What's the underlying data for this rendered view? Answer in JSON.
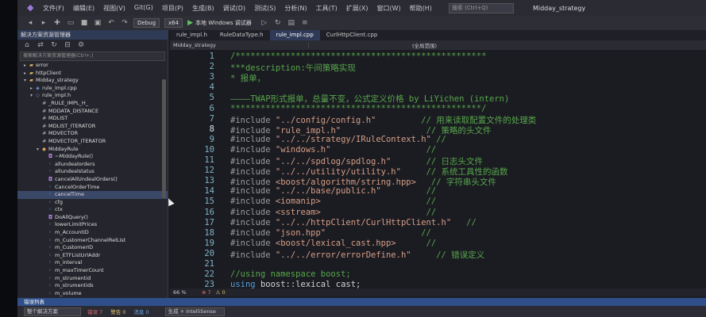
{
  "menubar": {
    "items": [
      "文件(F)",
      "编辑(E)",
      "视图(V)",
      "Git(G)",
      "项目(P)",
      "生成(B)",
      "调试(D)",
      "测试(S)",
      "分析(N)",
      "工具(T)",
      "扩展(X)",
      "窗口(W)",
      "帮助(H)"
    ],
    "search_placeholder": "搜索 (Ctrl+Q)",
    "app_title": "Midday_strategy"
  },
  "toolbar": {
    "config": "Debug",
    "platform": "x64",
    "run_label": "本地 Windows 调试器"
  },
  "solution_explorer": {
    "title": "解决方案资源管理器",
    "search_placeholder": "搜索解决方案资源管理器(Ctrl+;)",
    "items": [
      {
        "label": "error",
        "indent": 1,
        "arrow": "▸",
        "icon": "folder"
      },
      {
        "label": "httpClient",
        "indent": 1,
        "arrow": "▸",
        "icon": "folder"
      },
      {
        "label": "Midday_strategy",
        "indent": 1,
        "arrow": "▾",
        "icon": "folder"
      },
      {
        "label": "rule_impl.cpp",
        "indent": 2,
        "arrow": "▸",
        "icon": "cpp"
      },
      {
        "label": "rule_impl.h",
        "indent": 2,
        "arrow": "▾",
        "icon": "h"
      },
      {
        "label": "_RULE_IMPL_H_",
        "indent": 3,
        "arrow": "",
        "icon": "macro"
      },
      {
        "label": "MDDATA_DISTANCE",
        "indent": 3,
        "arrow": "",
        "icon": "macro"
      },
      {
        "label": "MDLIST",
        "indent": 3,
        "arrow": "",
        "icon": "macro"
      },
      {
        "label": "MDLIST_ITERATOR",
        "indent": 3,
        "arrow": "",
        "icon": "macro"
      },
      {
        "label": "MDVECTOR",
        "indent": 3,
        "arrow": "",
        "icon": "macro"
      },
      {
        "label": "MDVECTOR_ITERATOR",
        "indent": 3,
        "arrow": "",
        "icon": "macro"
      },
      {
        "label": "MiddayRule",
        "indent": 3,
        "arrow": "▾",
        "icon": "class"
      },
      {
        "label": "~MiddayRule()",
        "indent": 4,
        "arrow": "",
        "icon": "method"
      },
      {
        "label": "allundealorders",
        "indent": 4,
        "arrow": "",
        "icon": "field"
      },
      {
        "label": "allundealstatus",
        "indent": 4,
        "arrow": "",
        "icon": "field"
      },
      {
        "label": "cancelAllUndealOrders()",
        "indent": 4,
        "arrow": "",
        "icon": "method"
      },
      {
        "label": "CancelOrderTime",
        "indent": 4,
        "arrow": "",
        "icon": "field"
      },
      {
        "label": "cancelTime",
        "indent": 4,
        "arrow": "",
        "icon": "field",
        "selected": true
      },
      {
        "label": "cfg",
        "indent": 4,
        "arrow": "",
        "icon": "field"
      },
      {
        "label": "ctx",
        "indent": 4,
        "arrow": "",
        "icon": "field"
      },
      {
        "label": "DoAllQuery()",
        "indent": 4,
        "arrow": "",
        "icon": "method"
      },
      {
        "label": "lowerLimitPrices",
        "indent": 4,
        "arrow": "",
        "icon": "field"
      },
      {
        "label": "m_AccountID",
        "indent": 4,
        "arrow": "",
        "icon": "field"
      },
      {
        "label": "m_CustomerChannelRelList",
        "indent": 4,
        "arrow": "",
        "icon": "field"
      },
      {
        "label": "m_CustomerID",
        "indent": 4,
        "arrow": "",
        "icon": "field"
      },
      {
        "label": "m_ETFListUrlAddr",
        "indent": 4,
        "arrow": "",
        "icon": "field"
      },
      {
        "label": "m_interval",
        "indent": 4,
        "arrow": "",
        "icon": "field"
      },
      {
        "label": "m_maxTimerCount",
        "indent": 4,
        "arrow": "",
        "icon": "field"
      },
      {
        "label": "m_strumentid",
        "indent": 4,
        "arrow": "",
        "icon": "field"
      },
      {
        "label": "m_strumentids",
        "indent": 4,
        "arrow": "",
        "icon": "field"
      },
      {
        "label": "m_volume",
        "indent": 4,
        "arrow": "",
        "icon": "field"
      }
    ]
  },
  "tabs": [
    {
      "label": "rule_impl.h",
      "active": false
    },
    {
      "label": "RuleDataType.h",
      "active": false
    },
    {
      "label": "rule_impl.cpp",
      "active": true
    },
    {
      "label": "CurlHttpClient.cpp",
      "active": false
    }
  ],
  "nav": {
    "project": "Midday_strategy",
    "scope": "(全局范围)"
  },
  "editor": {
    "active_line": "8",
    "lines": [
      {
        "num": "1",
        "parts": [
          [
            "c-cmt",
            "/**************************************************"
          ]
        ]
      },
      {
        "num": "2",
        "parts": [
          [
            "c-cmt",
            "***description:午间策略实现"
          ]
        ]
      },
      {
        "num": "3",
        "parts": [
          [
            "c-cmt",
            "* 报单，"
          ]
        ]
      },
      {
        "num": "4",
        "parts": [
          [
            "c-cmt",
            ""
          ]
        ]
      },
      {
        "num": "5",
        "parts": [
          [
            "c-cmt",
            "————TWAP形式报单，总量不变，公式定义价格 by LiYichen (intern)"
          ]
        ]
      },
      {
        "num": "6",
        "parts": [
          [
            "c-cmt",
            "**************************************************/"
          ]
        ]
      },
      {
        "num": "7",
        "parts": [
          [
            "c-pp",
            "#include "
          ],
          [
            "c-str",
            "\"../config/config.h\""
          ],
          [
            "c-def",
            "         "
          ],
          [
            "c-cmt",
            "// 用来读取配置文件的处理类"
          ]
        ]
      },
      {
        "num": "8",
        "parts": [
          [
            "c-pp",
            "#include "
          ],
          [
            "c-str",
            "\"rule_impl.h\""
          ],
          [
            "c-def",
            "                 "
          ],
          [
            "c-cmt",
            "// 策略的头文件"
          ]
        ]
      },
      {
        "num": "9",
        "parts": [
          [
            "c-pp",
            "#include "
          ],
          [
            "c-str",
            "\"../../strategy/IRuleContext.h\""
          ],
          [
            "c-def",
            " "
          ],
          [
            "c-cmt",
            "//"
          ]
        ]
      },
      {
        "num": "10",
        "parts": [
          [
            "c-pp",
            "#include "
          ],
          [
            "c-str",
            "\"windows.h\""
          ],
          [
            "c-def",
            "                   "
          ],
          [
            "c-cmt",
            "//"
          ]
        ]
      },
      {
        "num": "11",
        "parts": [
          [
            "c-pp",
            "#include "
          ],
          [
            "c-str",
            "\"../../spdlog/spdlog.h\""
          ],
          [
            "c-def",
            "       "
          ],
          [
            "c-cmt",
            "// 日志头文件"
          ]
        ]
      },
      {
        "num": "12",
        "parts": [
          [
            "c-pp",
            "#include "
          ],
          [
            "c-str",
            "\"../../utility/utility.h\""
          ],
          [
            "c-def",
            "     "
          ],
          [
            "c-cmt",
            "// 系统工具性的函数"
          ]
        ]
      },
      {
        "num": "13",
        "parts": [
          [
            "c-pp",
            "#include "
          ],
          [
            "c-str",
            "<boost/algorithm/string.hpp>"
          ],
          [
            "c-def",
            "   "
          ],
          [
            "c-cmt",
            "// 字符串头文件"
          ]
        ]
      },
      {
        "num": "14",
        "parts": [
          [
            "c-pp",
            "#include "
          ],
          [
            "c-str",
            "\"../../base/public.h\""
          ],
          [
            "c-def",
            "         "
          ],
          [
            "c-cmt",
            "//"
          ]
        ]
      },
      {
        "num": "15",
        "parts": [
          [
            "c-pp",
            "#include "
          ],
          [
            "c-str",
            "<iomanip>"
          ],
          [
            "c-def",
            "                     "
          ],
          [
            "c-cmt",
            "//"
          ]
        ]
      },
      {
        "num": "16",
        "parts": [
          [
            "c-pp",
            "#include "
          ],
          [
            "c-str",
            "<sstream>"
          ],
          [
            "c-def",
            "                     "
          ],
          [
            "c-cmt",
            "//"
          ]
        ]
      },
      {
        "num": "17",
        "parts": [
          [
            "c-pp",
            "#include "
          ],
          [
            "c-str",
            "\"../../httpClient/CurlHttpClient.h\""
          ],
          [
            "c-def",
            "   "
          ],
          [
            "c-cmt",
            "//"
          ]
        ]
      },
      {
        "num": "18",
        "parts": [
          [
            "c-pp",
            "#include "
          ],
          [
            "c-str",
            "\"json.hpp\""
          ],
          [
            "c-def",
            "                   "
          ],
          [
            "c-cmt",
            "//"
          ]
        ]
      },
      {
        "num": "19",
        "parts": [
          [
            "c-pp",
            "#include "
          ],
          [
            "c-str",
            "<boost/lexical_cast.hpp>"
          ],
          [
            "c-def",
            "      "
          ],
          [
            "c-cmt",
            "//"
          ]
        ]
      },
      {
        "num": "20",
        "parts": [
          [
            "c-pp",
            "#include "
          ],
          [
            "c-str",
            "\"../../error/errorDefine.h\""
          ],
          [
            "c-def",
            "     "
          ],
          [
            "c-cmt",
            "// 错误定义"
          ]
        ]
      },
      {
        "num": "21",
        "parts": [
          [
            "c-def",
            ""
          ]
        ]
      },
      {
        "num": "22",
        "parts": [
          [
            "c-cmt",
            "//using namespace boost;"
          ]
        ]
      },
      {
        "num": "23",
        "parts": [
          [
            "c-kw",
            "using "
          ],
          [
            "c-def",
            "boost::lexical_cast;"
          ]
        ]
      }
    ]
  },
  "status": {
    "zoom": "66 %",
    "errors": "⊗ 7",
    "warnings": "⚠ 0"
  },
  "error_list": {
    "title": "错误列表",
    "scope": "整个解决方案",
    "errors": "错误 7",
    "warnings": "警告 0",
    "messages": "消息 0",
    "build": "生成 + IntelliSense"
  }
}
